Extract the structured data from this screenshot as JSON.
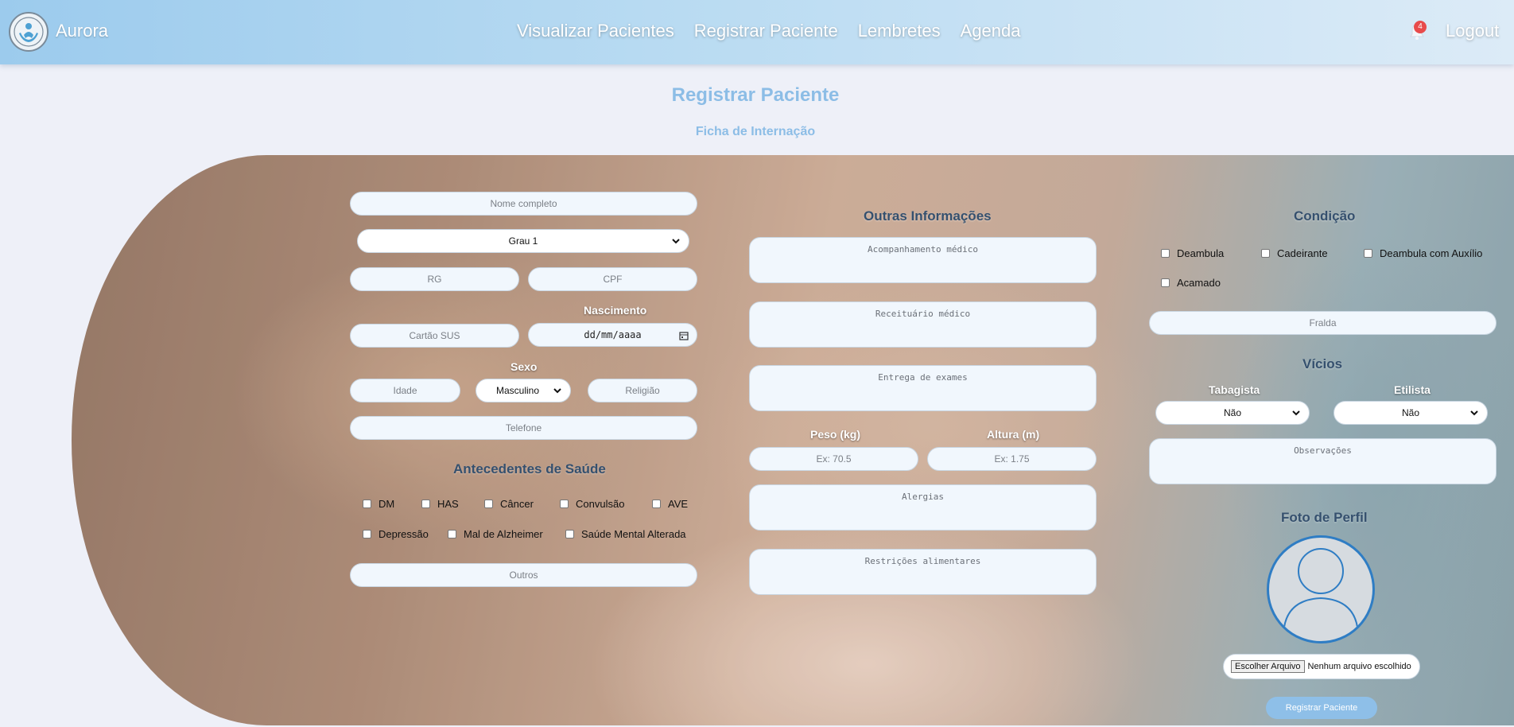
{
  "brand": {
    "name": "Aurora"
  },
  "nav": {
    "items": [
      {
        "label": "Visualizar Pacientes"
      },
      {
        "label": "Registrar Paciente"
      },
      {
        "label": "Lembretes"
      },
      {
        "label": "Agenda"
      }
    ],
    "notification_count": "4",
    "logout": "Logout"
  },
  "page": {
    "title": "Registrar Paciente",
    "subtitle": "Ficha de Internação"
  },
  "personal": {
    "nome_placeholder": "Nome completo",
    "grau_value": "Grau 1",
    "rg_placeholder": "RG",
    "cpf_placeholder": "CPF",
    "nascimento_label": "Nascimento",
    "cartao_placeholder": "Cartão SUS",
    "date_placeholder": "dd/mm/aaaa",
    "sexo_label": "Sexo",
    "idade_placeholder": "Idade",
    "sexo_value": "Masculino",
    "religiao_placeholder": "Religião",
    "telefone_placeholder": "Telefone"
  },
  "antecedentes": {
    "title": "Antecedentes de Saúde",
    "items": [
      "DM",
      "HAS",
      "Câncer",
      "Convulsão",
      "AVE",
      "Depressão",
      "Mal de Alzheimer",
      "Saúde Mental Alterada"
    ],
    "outros_placeholder": "Outros"
  },
  "outras": {
    "title": "Outras Informações",
    "acompanhamento_placeholder": "Acompanhamento médico",
    "receituario_placeholder": "Receituário médico",
    "exames_placeholder": "Entrega de exames",
    "peso_label": "Peso (kg)",
    "altura_label": "Altura (m)",
    "peso_placeholder": "Ex: 70.5",
    "altura_placeholder": "Ex: 1.75",
    "alergias_placeholder": "Alergias",
    "restricoes_placeholder": "Restrições alimentares"
  },
  "condicao": {
    "title": "Condição",
    "items": [
      "Deambula",
      "Cadeirante",
      "Deambula com Auxílio",
      "Acamado"
    ],
    "fralda_placeholder": "Fralda"
  },
  "vicios": {
    "title": "Vícios",
    "tabagista_label": "Tabagista",
    "tabagista_value": "Não",
    "etilista_label": "Etilista",
    "etilista_value": "Não",
    "observacoes_placeholder": "Observações"
  },
  "foto": {
    "title": "Foto de Perfil",
    "file_button": "Escolher Arquivo",
    "file_status": "Nenhum arquivo escolhido"
  },
  "submit": {
    "label": "Registrar Paciente"
  },
  "colors": {
    "accent": "#8cbde6",
    "avatar_border": "#2f7dc4",
    "badge": "#e84b4b"
  }
}
